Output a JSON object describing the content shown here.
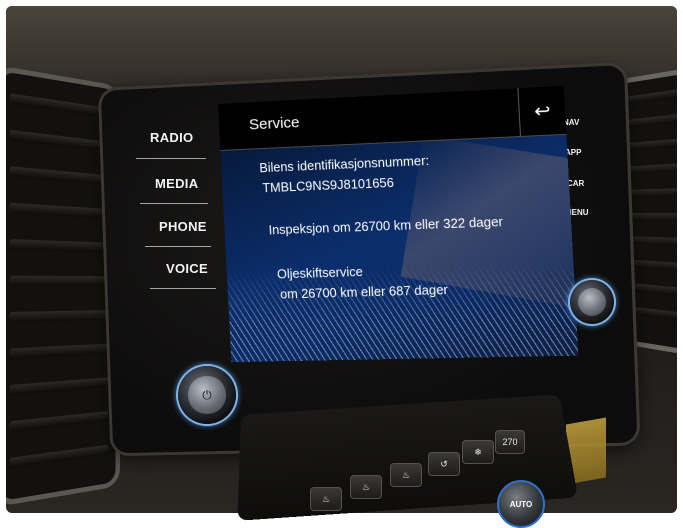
{
  "side_buttons": [
    "RADIO",
    "MEDIA",
    "PHONE",
    "VOICE"
  ],
  "right_buttons": [
    "NAV",
    "APP",
    "CAR",
    "MENU"
  ],
  "screen": {
    "title": "Service",
    "back_icon": "back-arrow-icon",
    "vin_label": "Bilens identifikasjonsnummer:",
    "vin_value": "TMBLC9NS9J8101656",
    "inspection": "Inspeksjon om 26700 km eller 322 dager",
    "oil_title": "Oljeskiftservice",
    "oil_value": "om 26700 km eller 687 dager"
  },
  "console": {
    "display_value": "270",
    "auto_label": "AUTO"
  }
}
